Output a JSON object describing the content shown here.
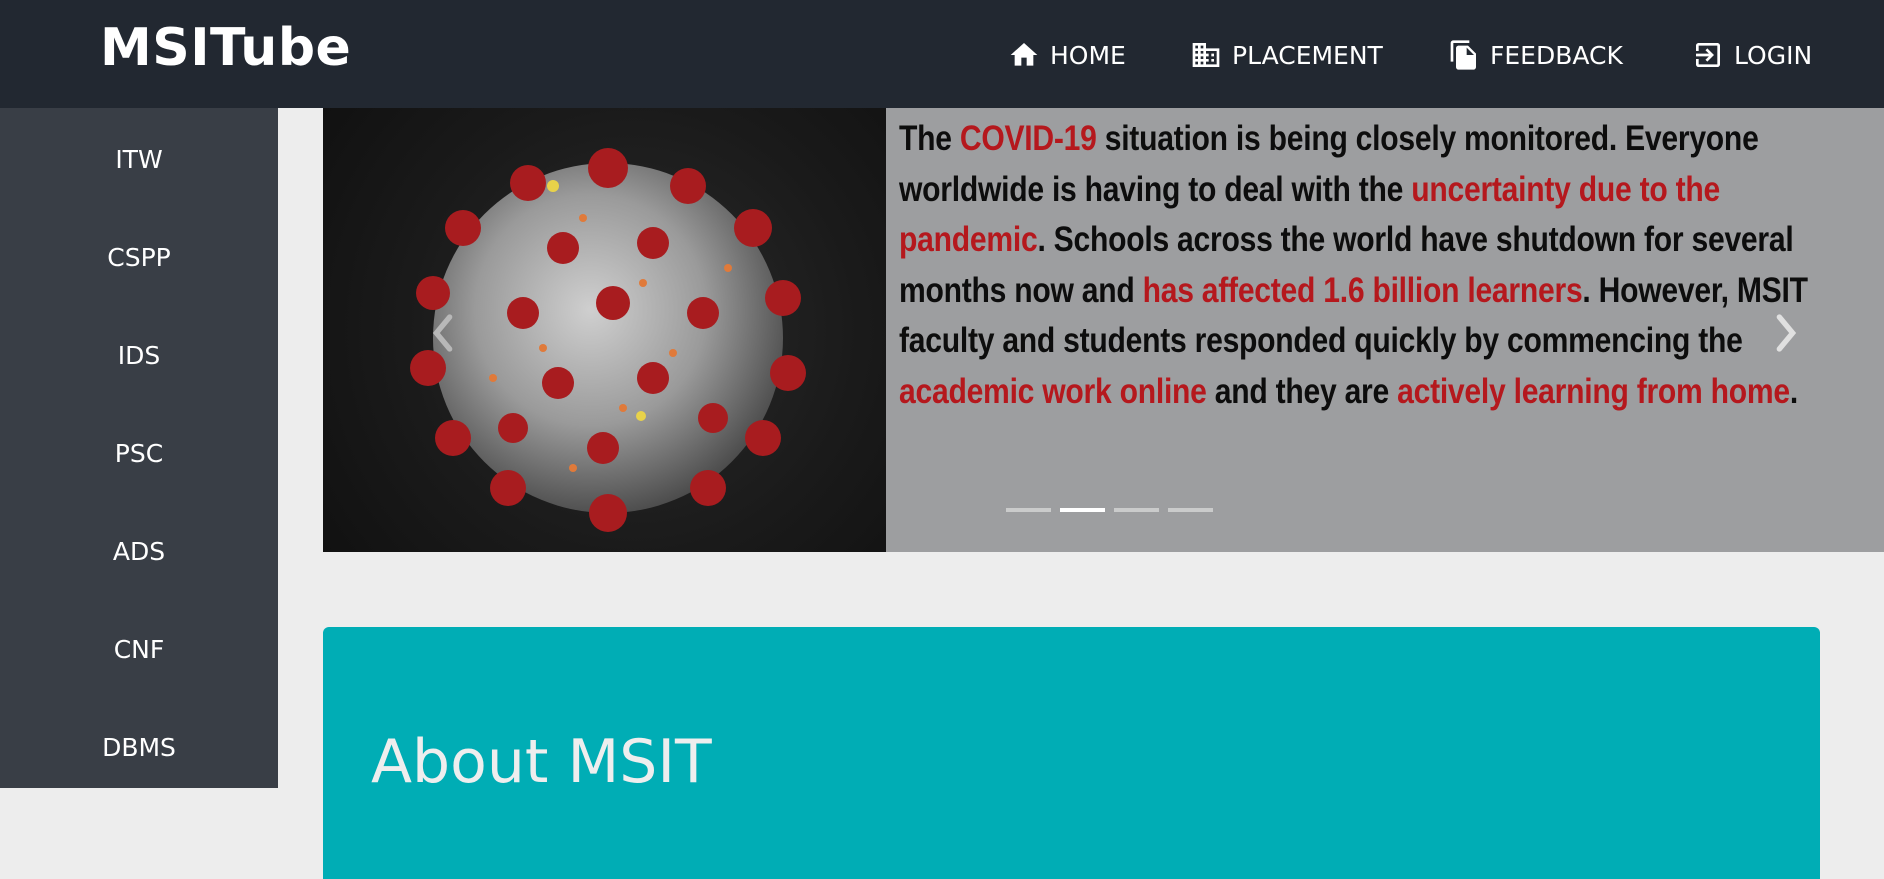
{
  "brand": "MSITube",
  "nav": {
    "home": "HOME",
    "placement": "PLACEMENT",
    "feedback": "FEEDBACK",
    "login": "LOGIN"
  },
  "sidebar": {
    "items": [
      {
        "label": "ITW"
      },
      {
        "label": "CSPP"
      },
      {
        "label": "IDS"
      },
      {
        "label": "PSC"
      },
      {
        "label": "ADS"
      },
      {
        "label": "CNF"
      },
      {
        "label": "DBMS"
      }
    ]
  },
  "carousel": {
    "slide_caption": {
      "p1": "The ",
      "h1": "COVID-19",
      "p2": " situation is being closely monitored. Everyone worldwide is having to deal with the ",
      "h2": "uncertainty due to the pandemic",
      "p3": ". Schools across the world have shutdown for several months now and ",
      "h3": "has affected 1.6 billion learners",
      "p4": ". However, MSIT faculty and students responded quickly by commencing the ",
      "h4": "academic work online",
      "p5": " and they are ",
      "h5": "actively learning from home",
      "p6": "."
    },
    "indicator_count": 4,
    "active_indicator": 2
  },
  "about": {
    "title": "About MSIT"
  },
  "colors": {
    "navbar": "#222831",
    "sidebar": "#393e46",
    "accent": "#00adb5",
    "highlight": "#b5181d",
    "page_bg": "#ededed"
  },
  "icons": {
    "home": "home-icon",
    "placement": "building-icon",
    "feedback": "documents-icon",
    "login": "login-icon"
  }
}
